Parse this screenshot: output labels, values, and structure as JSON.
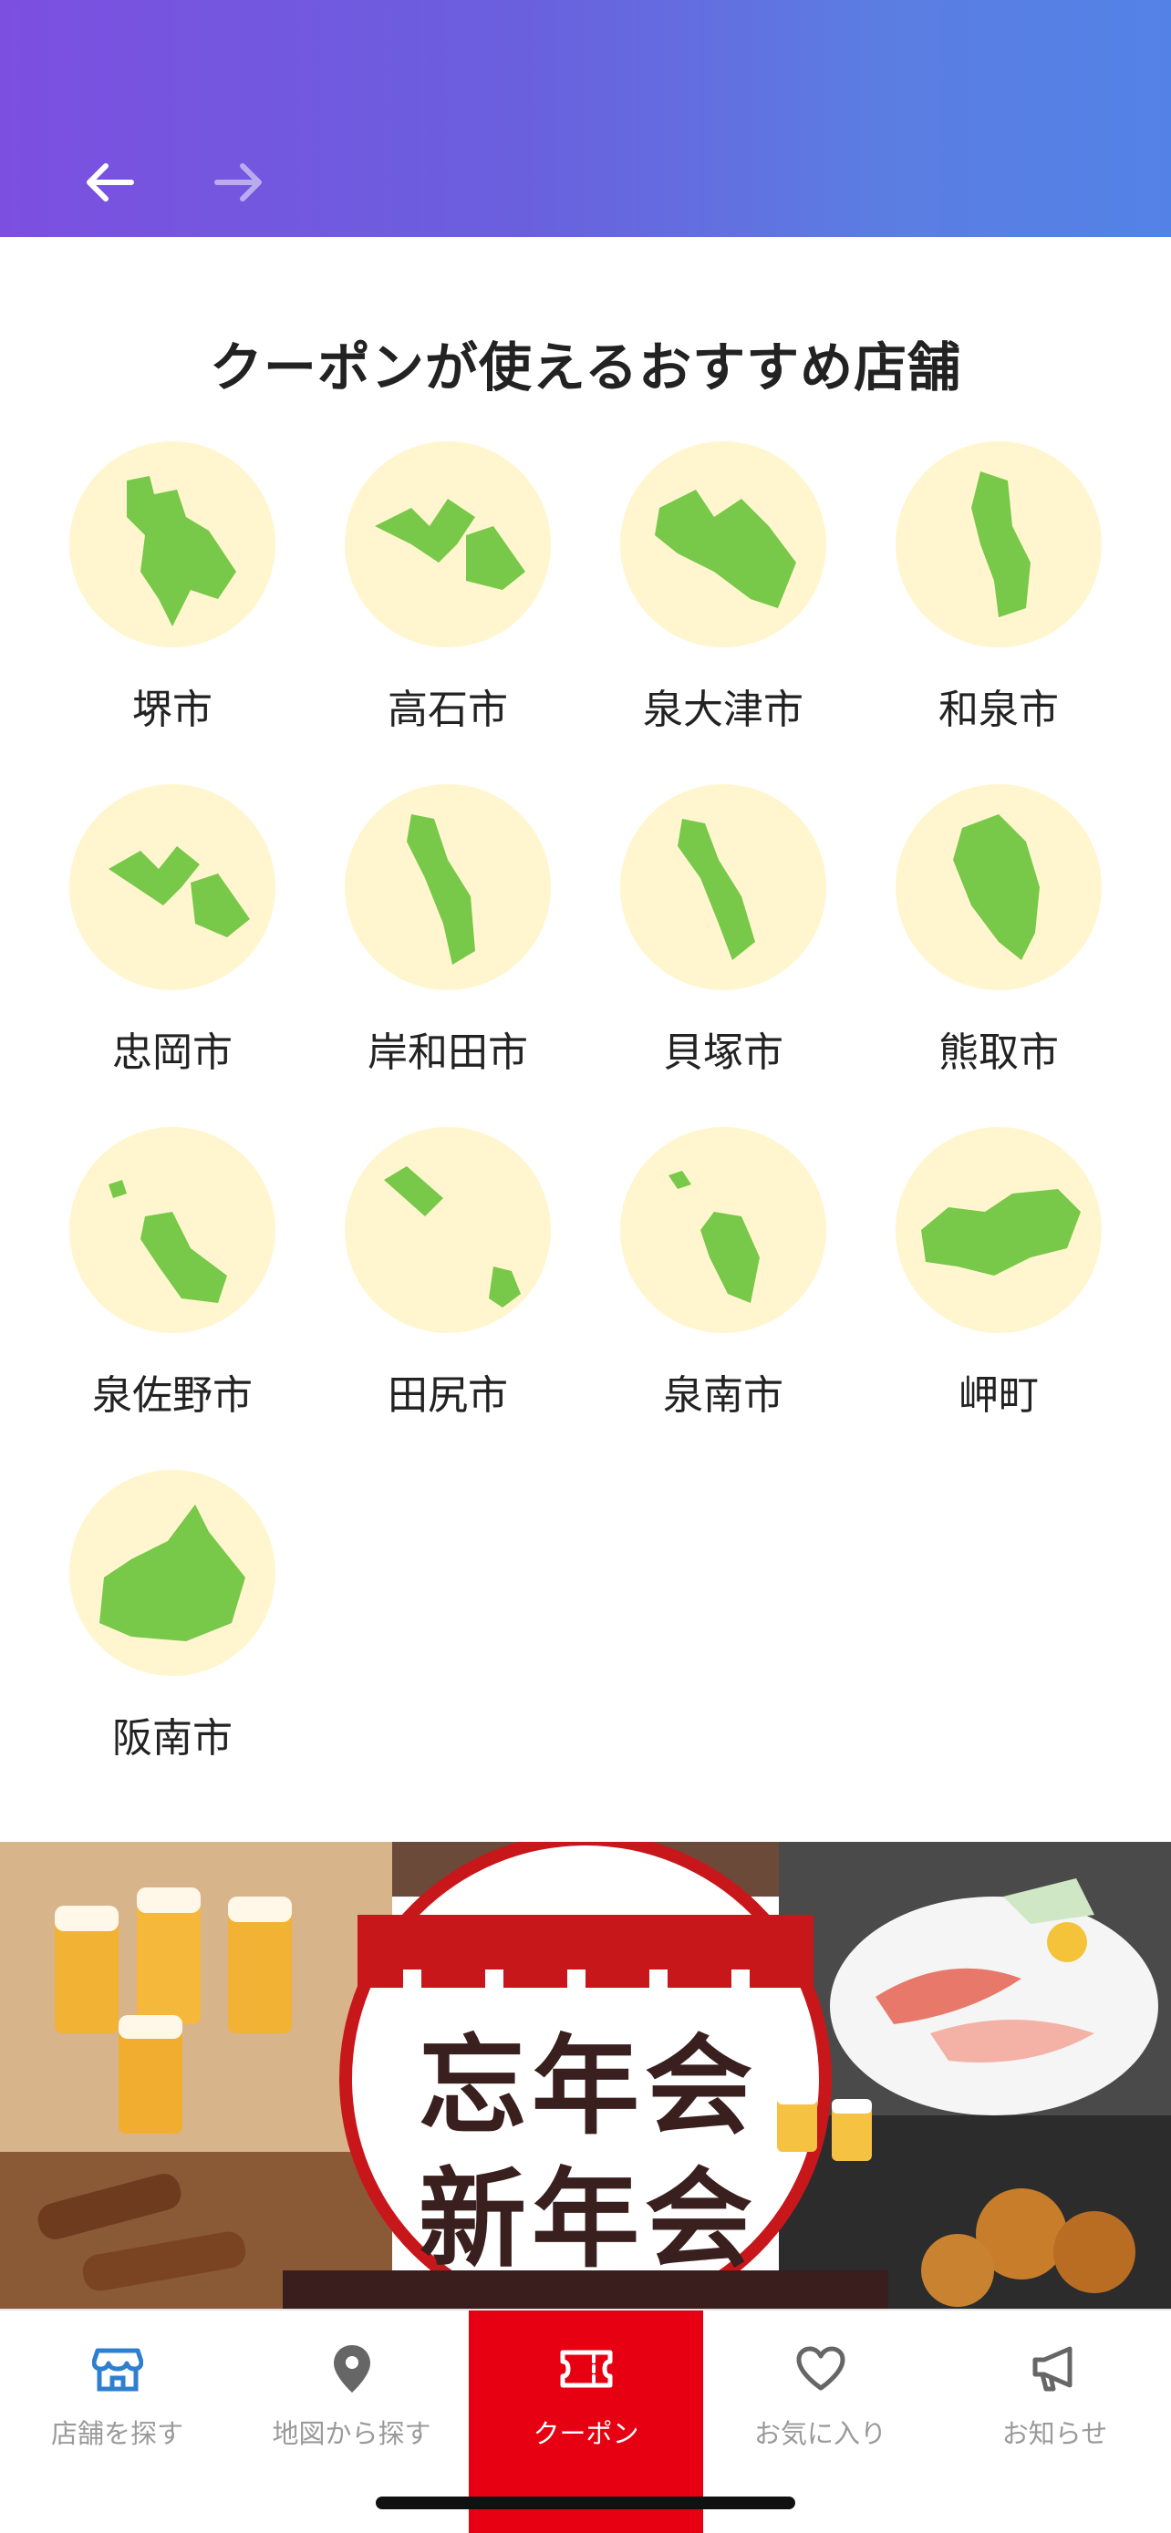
{
  "header": {
    "back_icon": "arrow-left-icon",
    "forward_icon": "arrow-right-icon",
    "gradient_start": "#7c4fe0",
    "gradient_end": "#5382e6"
  },
  "section": {
    "title": "クーポンが使えるおすすめ店舗"
  },
  "cities": [
    {
      "name": "堺市"
    },
    {
      "name": "高石市"
    },
    {
      "name": "泉大津市"
    },
    {
      "name": "和泉市"
    },
    {
      "name": "忠岡市"
    },
    {
      "name": "岸和田市"
    },
    {
      "name": "貝塚市"
    },
    {
      "name": "熊取市"
    },
    {
      "name": "泉佐野市"
    },
    {
      "name": "田尻市"
    },
    {
      "name": "泉南市"
    },
    {
      "name": "岬町"
    },
    {
      "name": "阪南市"
    }
  ],
  "banner": {
    "title_line1": "忘年会",
    "title_line2": "新年会"
  },
  "tabbar": {
    "tabs": [
      {
        "label": "店舗を探す",
        "icon": "store-icon",
        "active": false
      },
      {
        "label": "地図から探す",
        "icon": "map-pin-icon",
        "active": false
      },
      {
        "label": "クーポン",
        "icon": "ticket-icon",
        "active": true
      },
      {
        "label": "お気に入り",
        "icon": "heart-icon",
        "active": false
      },
      {
        "label": "お知らせ",
        "icon": "megaphone-icon",
        "active": false
      }
    ],
    "active_color": "#e60012",
    "store_icon_color": "#2f7fd0"
  },
  "colors": {
    "map_green": "#78c84a",
    "circle_bg": "#fff6cf"
  }
}
